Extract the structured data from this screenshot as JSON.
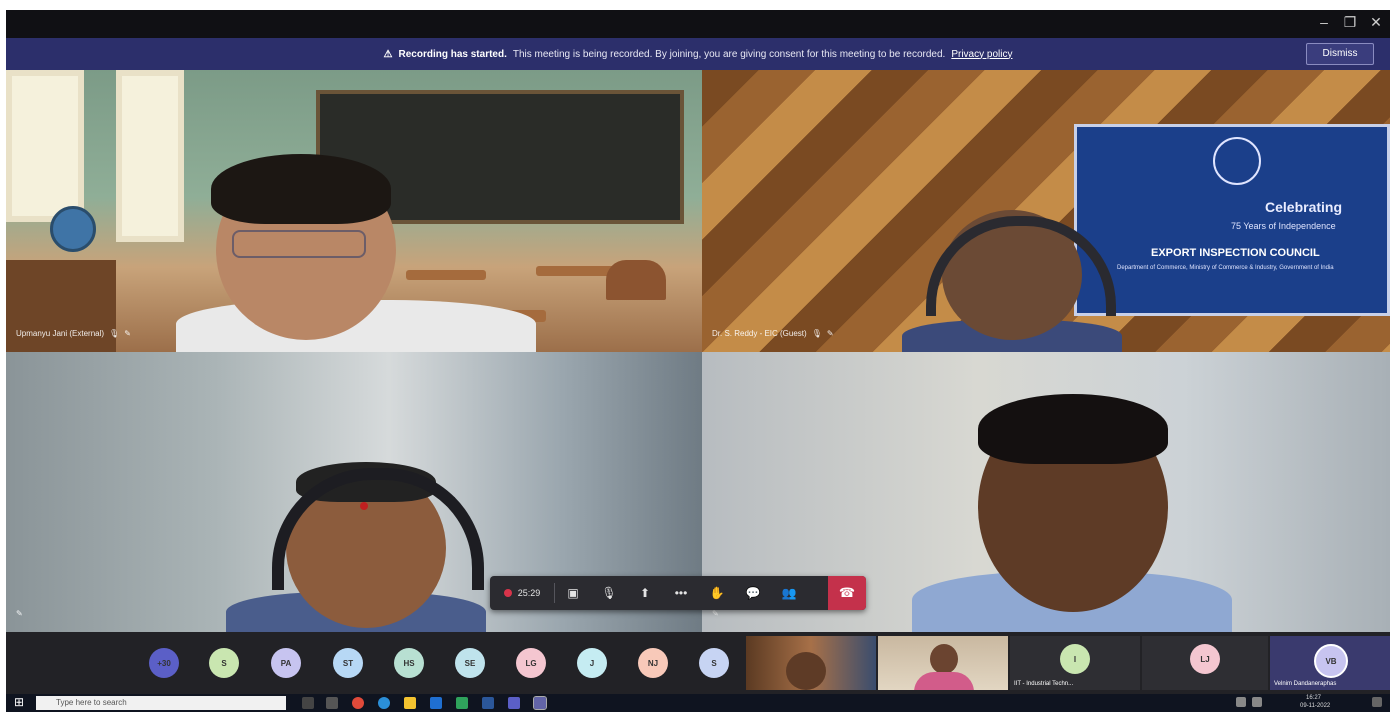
{
  "window": {
    "minimize": "–",
    "restore": "❐",
    "close": "✕"
  },
  "banner": {
    "icon": "⚠",
    "title": "Recording has started.",
    "message": "This meeting is being recorded. By joining, you are giving consent for this meeting to be recorded.",
    "link": "Privacy policy",
    "dismiss": "Dismiss"
  },
  "tiles": [
    {
      "name": "Upmanyu Jani (External)",
      "mic": "🎙",
      "pin": "✎"
    },
    {
      "name": "Dr. S. Reddy - EIC (Guest)",
      "mic": "🎙",
      "pin": "✎"
    },
    {
      "name": "",
      "mic": "",
      "pin": "✎"
    },
    {
      "name": "",
      "mic": "",
      "pin": "✎"
    }
  ],
  "eic_banner": {
    "line1": "Celebrating",
    "line2": "75 Years of Independence",
    "line3": "EXPORT INSPECTION COUNCIL",
    "line4": "Department of Commerce, Ministry of Commerce & Industry, Government of India"
  },
  "controls": {
    "timer": "25:29",
    "camera": "▣",
    "mic": "🎙",
    "share": "⬆",
    "more": "•••",
    "hand": "✋",
    "chat": "💬",
    "participants": "👥",
    "leave": "☎"
  },
  "participants": [
    {
      "initials": "+30",
      "color": "#5b5fc7"
    },
    {
      "initials": "S",
      "color": "#c9e6b0"
    },
    {
      "initials": "PA",
      "color": "#c7c4f0"
    },
    {
      "initials": "ST",
      "color": "#b7d8f5"
    },
    {
      "initials": "HS",
      "color": "#b8e0d2"
    },
    {
      "initials": "SE",
      "color": "#bfe3ec"
    },
    {
      "initials": "LG",
      "color": "#f4c6d0"
    },
    {
      "initials": "J",
      "color": "#c5ecf2"
    },
    {
      "initials": "NJ",
      "color": "#f8c9b9"
    },
    {
      "initials": "S",
      "color": "#c7d4f3"
    }
  ],
  "strip_tiles": [
    {
      "label": ""
    },
    {
      "label": ""
    },
    {
      "label": "IIT - Industrial Techn...",
      "initials": "I",
      "color": "#c9e6b0"
    },
    {
      "label": "",
      "initials": "LJ",
      "color": "#f4c6d0"
    },
    {
      "label": "Velnim Dandaneraphas",
      "initials": "VB",
      "color": "#c7c4f0"
    }
  ],
  "taskbar": {
    "start": "⊞",
    "search_placeholder": "Type here to search",
    "tray_time": "16:27",
    "tray_date": "09-11-2022"
  }
}
